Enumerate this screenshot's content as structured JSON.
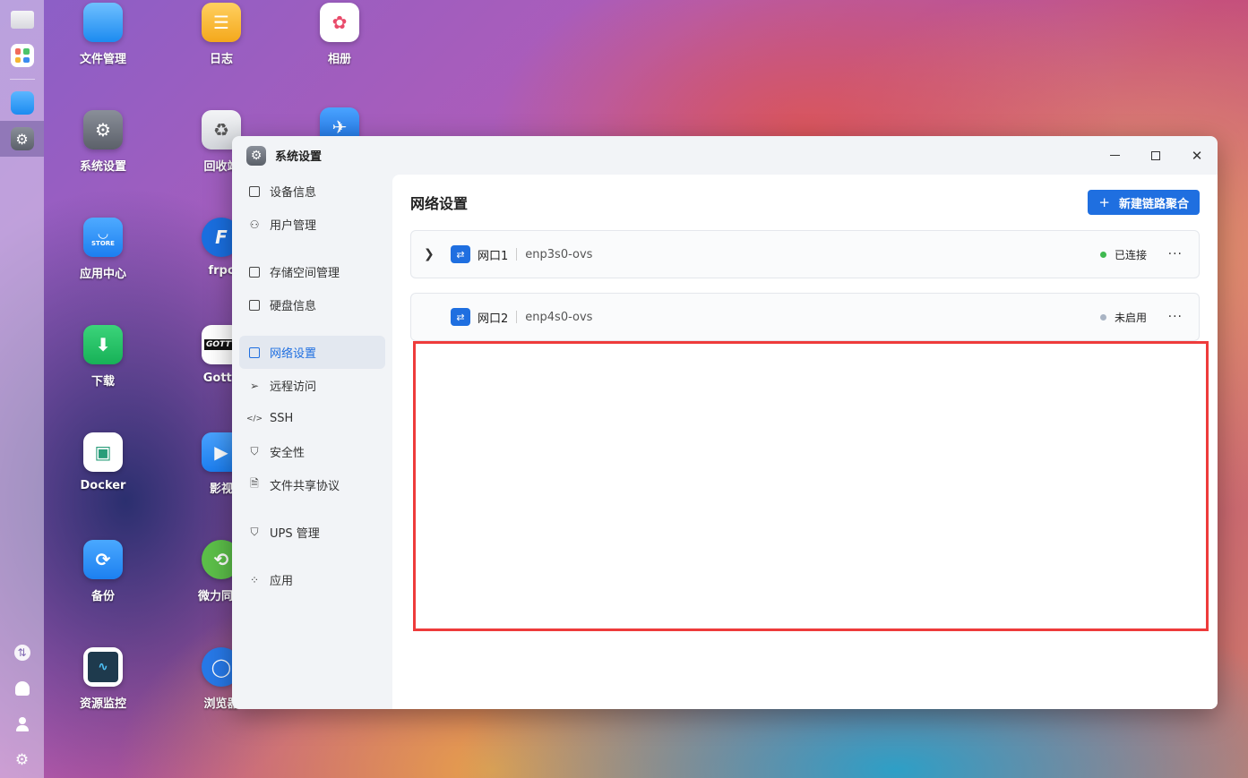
{
  "desktop": {
    "icons": [
      {
        "label": "文件管理",
        "icon": "folder-icon",
        "color": "#2c93f2"
      },
      {
        "label": "日志",
        "icon": "log-icon",
        "color": "#f6b52b"
      },
      {
        "label": "相册",
        "icon": "photos-icon",
        "color": "#ffffff"
      },
      {
        "label": "系统设置",
        "icon": "gear-icon",
        "color": "#6b7079"
      },
      {
        "label": "回收站",
        "icon": "recycle-icon",
        "color": "#e6e8ec"
      },
      {
        "label": "应用中心",
        "icon": "store-icon",
        "color": "#2c8ff0"
      },
      {
        "label": "frpc",
        "icon": "frpc-icon",
        "color": "#1a6fe0"
      },
      {
        "label": "下载",
        "icon": "download-icon",
        "color": "#1fc264"
      },
      {
        "label": "Gotty",
        "icon": "gotty-icon",
        "color": "#ffffff"
      },
      {
        "label": "Docker",
        "icon": "docker-icon",
        "color": "#ffffff"
      },
      {
        "label": "影视",
        "icon": "video-icon",
        "color": "#2d8df0"
      },
      {
        "label": "备份",
        "icon": "backup-icon",
        "color": "#2f98f0"
      },
      {
        "label": "微力同步",
        "icon": "sync-icon",
        "color": "#5cbf49"
      },
      {
        "label": "资源监控",
        "icon": "monitor-icon",
        "color": "#1e3a4d"
      },
      {
        "label": "浏览器",
        "icon": "browser-icon",
        "color": "#2779e8"
      }
    ],
    "store_badge": "STORE",
    "gotty_badge": "GOTTY"
  },
  "window": {
    "title": "系统设置"
  },
  "sidebar": {
    "items": [
      {
        "label": "设备信息",
        "icon": "device-icon"
      },
      {
        "label": "用户管理",
        "icon": "user-icon"
      },
      {
        "label": "存储空间管理",
        "icon": "storage-icon"
      },
      {
        "label": "硬盘信息",
        "icon": "disk-icon"
      },
      {
        "label": "网络设置",
        "icon": "network-icon",
        "active": true
      },
      {
        "label": "远程访问",
        "icon": "send-icon"
      },
      {
        "label": "SSH",
        "icon": "code-icon"
      },
      {
        "label": "安全性",
        "icon": "shield-check-icon"
      },
      {
        "label": "文件共享协议",
        "icon": "file-icon"
      },
      {
        "label": "UPS 管理",
        "icon": "shield-icon"
      },
      {
        "label": "应用",
        "icon": "apps-icon"
      }
    ]
  },
  "main": {
    "title": "网络设置",
    "new_button": "新建链路聚合",
    "ports": [
      {
        "name": "网口1",
        "device": "enp3s0-ovs",
        "status": "已连接",
        "status_color": "#3fb950",
        "expandable": true
      },
      {
        "name": "网口2",
        "device": "enp4s0-ovs",
        "status": "未启用",
        "status_color": "#a9b4c4",
        "expandable": false
      }
    ]
  },
  "colors": {
    "accent": "#1f6fe0",
    "highlight": "#ee3b3b"
  }
}
